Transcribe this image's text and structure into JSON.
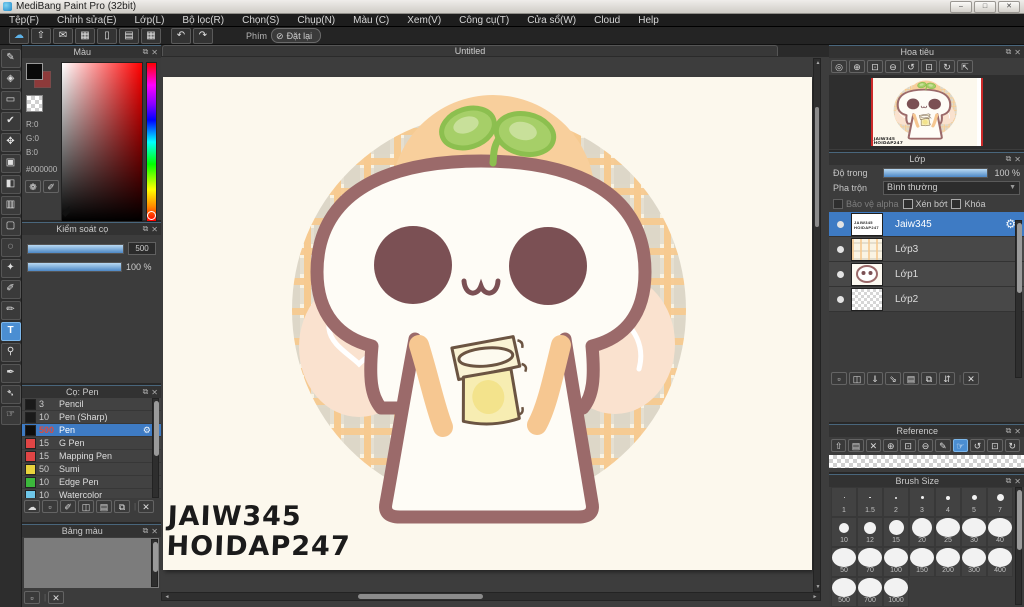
{
  "window": {
    "title": "MediBang Paint Pro (32bit)"
  },
  "menu": {
    "items": [
      "Tệp(F)",
      "Chỉnh sửa(E)",
      "Lớp(L)",
      "Bộ lọc(R)",
      "Chọn(S)",
      "Chụp(N)",
      "Màu (C)",
      "Xem(V)",
      "Công cụ(T)",
      "Cửa sổ(W)",
      "Cloud",
      "Help"
    ]
  },
  "toolbar": {
    "buttons": [
      {
        "name": "cloud-button",
        "icon": "cloud",
        "blue": true
      },
      {
        "name": "upload-button",
        "icon": "upload"
      },
      {
        "name": "comment-button",
        "icon": "comment"
      },
      {
        "name": "broadcast-button",
        "icon": "screen"
      },
      {
        "name": "document-button",
        "icon": "document"
      },
      {
        "name": "panel-layout-button",
        "icon": "panel-list"
      },
      {
        "name": "material-button",
        "icon": "grid-pen"
      }
    ],
    "undo_icon": "undo",
    "redo_icon": "redo",
    "keys_label": "Phím",
    "reset_label": "Đặt lại",
    "reset_icon": "slash"
  },
  "tools": {
    "items": [
      {
        "name": "tool-brush",
        "icon": "brush"
      },
      {
        "name": "tool-eraser",
        "icon": "eraser"
      },
      {
        "name": "tool-figure",
        "icon": "figure"
      },
      {
        "name": "tool-snap",
        "icon": "snap"
      },
      {
        "name": "tool-move",
        "icon": "move"
      },
      {
        "name": "tool-fill-rect",
        "icon": "fill-rect"
      },
      {
        "name": "tool-bucket",
        "icon": "bucket"
      },
      {
        "name": "tool-gradient",
        "icon": "gradient"
      },
      {
        "name": "tool-select",
        "icon": "select"
      },
      {
        "name": "tool-lasso",
        "icon": "lasso"
      },
      {
        "name": "tool-magic-wand",
        "icon": "magic-wand"
      },
      {
        "name": "tool-select-pen",
        "icon": "select-pen"
      },
      {
        "name": "tool-select-eraser",
        "icon": "select-eraser"
      },
      {
        "name": "tool-text",
        "icon": "text",
        "selected": true
      },
      {
        "name": "tool-zoom",
        "icon": "zoom"
      },
      {
        "name": "tool-pen",
        "icon": "pen"
      },
      {
        "name": "tool-eyedropper",
        "icon": "eyedropper"
      },
      {
        "name": "tool-hand",
        "icon": "hand"
      }
    ]
  },
  "canvas": {
    "tab": "Untitled",
    "watermark_line1": "JAIW345",
    "watermark_line2": "HOIDAP247"
  },
  "panels": {
    "color": {
      "title": "Màu",
      "r": "R:0",
      "g": "G:0",
      "b": "B:0",
      "hex": "#000000",
      "buttons": [
        {
          "name": "palette-mode-button",
          "icon": "palette"
        },
        {
          "name": "color-edit-button",
          "icon": "select-pen"
        }
      ]
    },
    "brush_control": {
      "title": "Kiểm soát cọ",
      "size_value": "500",
      "opacity_value": "100 %"
    },
    "brush_list": {
      "title": "Cọ: Pen",
      "brushes": [
        {
          "size": "3",
          "name": "Pencil",
          "color": "#1a1a1a"
        },
        {
          "size": "10",
          "name": "Pen (Sharp)",
          "color": "#1a1a1a"
        },
        {
          "size": "500",
          "name": "Pen",
          "color": "#0d0d0d",
          "selected": true
        },
        {
          "size": "15",
          "name": "G Pen",
          "color": "#e04545"
        },
        {
          "size": "15",
          "name": "Mapping Pen",
          "color": "#e04545"
        },
        {
          "size": "50",
          "name": "Sumi",
          "color": "#e8d23c"
        },
        {
          "size": "10",
          "name": "Edge Pen",
          "color": "#3cb83c"
        },
        {
          "size": "10",
          "name": "Watercolor",
          "color": "#6ec6e8"
        }
      ],
      "footer": [
        {
          "name": "brush-cloud-button",
          "icon": "cloud"
        },
        {
          "name": "brush-add-button",
          "icon": "new"
        },
        {
          "name": "brush-add-pen-button",
          "icon": "select-pen"
        },
        {
          "name": "brush-duplicate-button",
          "icon": "duplicate"
        },
        {
          "name": "brush-folder-button",
          "icon": "folder"
        },
        {
          "name": "brush-copy-button",
          "icon": "copy"
        },
        {
          "name": "brush-delete-button",
          "icon": "delete"
        }
      ]
    },
    "palette": {
      "title": "Bảng màu",
      "footer": [
        {
          "name": "palette-add-button",
          "icon": "new"
        },
        {
          "name": "palette-delete-button",
          "icon": "delete"
        }
      ]
    },
    "navigator": {
      "title": "Hoa tiêu",
      "buttons": [
        {
          "name": "nav-zoom-reset-button",
          "icon": "zoom-reset"
        },
        {
          "name": "nav-zoom-in-button",
          "icon": "zoom-in"
        },
        {
          "name": "nav-fit-button",
          "icon": "fit"
        },
        {
          "name": "nav-zoom-out-button",
          "icon": "zoom-out"
        },
        {
          "name": "nav-rotate-left-button",
          "icon": "rotate-left"
        },
        {
          "name": "nav-rotate-reset-button",
          "icon": "fit"
        },
        {
          "name": "nav-rotate-right-button",
          "icon": "rotate-right"
        },
        {
          "name": "nav-lock-button",
          "icon": "lock"
        }
      ]
    },
    "layers": {
      "title": "Lớp",
      "opacity_label": "Độ trong",
      "opacity_value": "100 %",
      "blend_label": "Pha trộn",
      "blend_value": "Bình thường",
      "checkboxes": [
        {
          "label": "Bảo vệ alpha",
          "disabled": true
        },
        {
          "label": "Xén bớt"
        },
        {
          "label": "Khóa"
        }
      ],
      "items": [
        {
          "name": "Jaiw345",
          "selected": true,
          "thumb": "text"
        },
        {
          "name": "Lớp3",
          "thumb": "plaid"
        },
        {
          "name": "Lớp1",
          "thumb": "face"
        },
        {
          "name": "Lớp2",
          "thumb": "checker"
        }
      ],
      "footer": [
        {
          "name": "layer-add-button",
          "icon": "new"
        },
        {
          "name": "layer-duplicate-button",
          "icon": "duplicate"
        },
        {
          "name": "layer-merge-down-button",
          "icon": "down"
        },
        {
          "name": "layer-transfer-button",
          "icon": "transfer"
        },
        {
          "name": "layer-folder-button",
          "icon": "folder"
        },
        {
          "name": "layer-copy-button",
          "icon": "copy"
        },
        {
          "name": "layer-order-button",
          "icon": "swap"
        },
        {
          "name": "layer-delete-button",
          "icon": "delete"
        }
      ]
    },
    "reference": {
      "title": "Reference",
      "buttons": [
        {
          "name": "ref-cloud-button",
          "icon": "upload"
        },
        {
          "name": "ref-open-button",
          "icon": "folder"
        },
        {
          "name": "ref-clear-button",
          "icon": "delete"
        },
        {
          "name": "ref-zoom-in-button",
          "icon": "zoom-in"
        },
        {
          "name": "ref-fit-button",
          "icon": "fit"
        },
        {
          "name": "ref-zoom-out-button",
          "icon": "zoom-out"
        },
        {
          "name": "ref-picker-button",
          "icon": "brush"
        },
        {
          "name": "ref-hand-button",
          "icon": "hand",
          "selected": true
        },
        {
          "name": "ref-rotate-left-button",
          "icon": "rotate-left"
        },
        {
          "name": "ref-rotate-reset-button",
          "icon": "fit"
        },
        {
          "name": "ref-rotate-right-button",
          "icon": "rotate-right"
        }
      ]
    },
    "brush_size": {
      "title": "Brush Size",
      "sizes": [
        "1",
        "1.5",
        "2",
        "3",
        "4",
        "5",
        "7",
        "10",
        "12",
        "15",
        "20",
        "25",
        "30",
        "40",
        "50",
        "70",
        "100",
        "150",
        "200",
        "300",
        "400",
        "500",
        "700",
        "1000"
      ]
    }
  },
  "colors": {
    "accent": "#3e7bc4",
    "slider_blue": "#4d88c5",
    "canvas_cream": "#fcf8ed",
    "art_outline": "#9b6a6a",
    "art_eye": "#7b5054",
    "art_leaf": "#a6cf68",
    "art_plaid_orange": "#f6ca90",
    "art_plaid_gray": "#ded8c8",
    "art_peach": "#f6c791",
    "selected_size_red": "#e04a3a"
  }
}
